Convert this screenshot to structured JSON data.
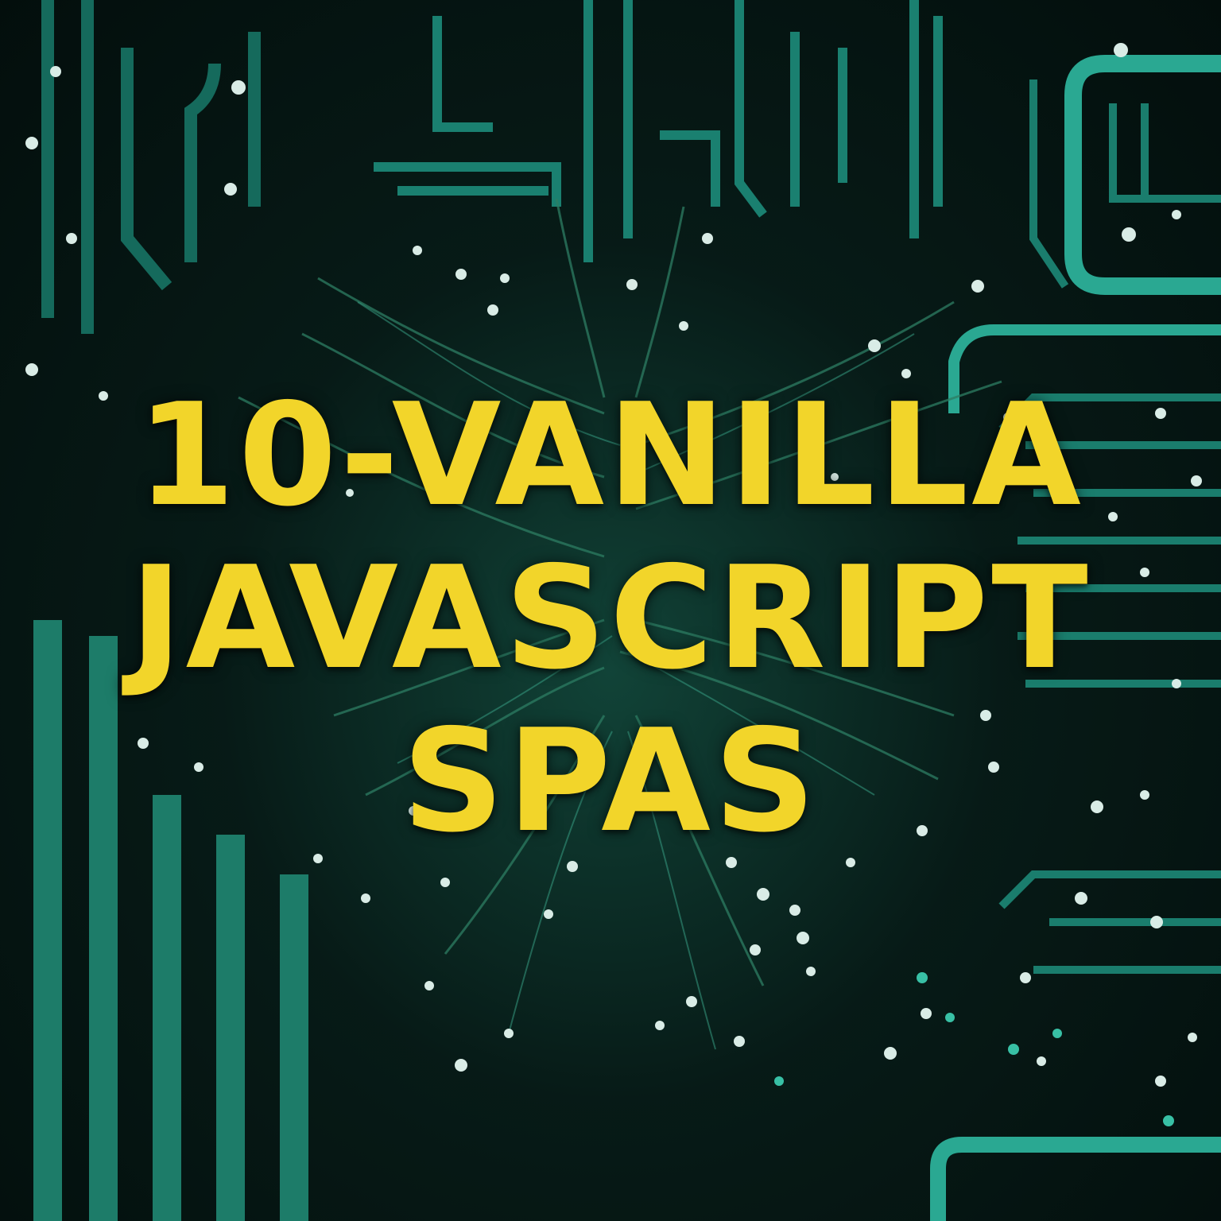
{
  "cover": {
    "title_lines": [
      "10-VANILLA",
      "JAVASCRIPT",
      "SPAS"
    ]
  },
  "colors": {
    "text": "#f2d52a",
    "trace": "#1f8f7f",
    "background": "#061714"
  },
  "background": {
    "subject": "circuit-board"
  }
}
